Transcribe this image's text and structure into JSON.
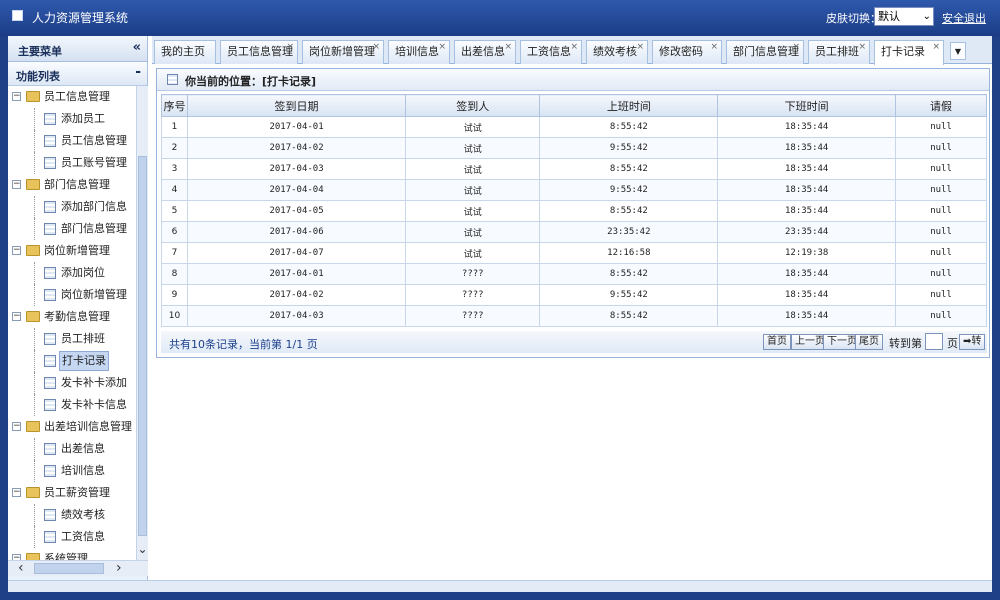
{
  "app": {
    "title": "人力资源管理系统",
    "skin_label": "皮肤切换：",
    "skin_value": "默认",
    "logout": "安全退出"
  },
  "sidebar": {
    "header": "主要菜单",
    "collapse_glyph": "«",
    "sub_header": "功能列表",
    "sub_toggle": "-",
    "groups": [
      {
        "label": "员工信息管理",
        "items": [
          "添加员工",
          "员工信息管理",
          "员工账号管理"
        ]
      },
      {
        "label": "部门信息管理",
        "items": [
          "添加部门信息",
          "部门信息管理"
        ]
      },
      {
        "label": "岗位新增管理",
        "items": [
          "添加岗位",
          "岗位新增管理"
        ]
      },
      {
        "label": "考勤信息管理",
        "items": [
          "员工排班",
          "打卡记录",
          "发卡补卡添加",
          "发卡补卡信息"
        ]
      },
      {
        "label": "出差培训信息管理",
        "items": [
          "出差信息",
          "培训信息"
        ]
      },
      {
        "label": "员工薪资管理",
        "items": [
          "绩效考核",
          "工资信息"
        ]
      },
      {
        "label": "系统管理",
        "items": []
      }
    ],
    "selected": "打卡记录"
  },
  "tabs": [
    "我的主页",
    "员工信息管理",
    "岗位新增管理",
    "培训信息",
    "出差信息",
    "工资信息",
    "绩效考核",
    "修改密码",
    "部门信息管理",
    "员工排班",
    "打卡记录"
  ],
  "active_tab": "打卡记录",
  "location": "你当前的位置：[打卡记录]",
  "table": {
    "headers": [
      "序号",
      "签到日期",
      "签到人",
      "上班时间",
      "下班时间",
      "请假"
    ],
    "rows": [
      [
        "1",
        "2017-04-01",
        "试试",
        "8:55:42",
        "18:35:44",
        "null"
      ],
      [
        "2",
        "2017-04-02",
        "试试",
        "9:55:42",
        "18:35:44",
        "null"
      ],
      [
        "3",
        "2017-04-03",
        "试试",
        "8:55:42",
        "18:35:44",
        "null"
      ],
      [
        "4",
        "2017-04-04",
        "试试",
        "9:55:42",
        "18:35:44",
        "null"
      ],
      [
        "5",
        "2017-04-05",
        "试试",
        "8:55:42",
        "18:35:44",
        "null"
      ],
      [
        "6",
        "2017-04-06",
        "试试",
        "23:35:42",
        "23:35:44",
        "null"
      ],
      [
        "7",
        "2017-04-07",
        "试试",
        "12:16:58",
        "12:19:38",
        "null"
      ],
      [
        "8",
        "2017-04-01",
        "????",
        "8:55:42",
        "18:35:44",
        "null"
      ],
      [
        "9",
        "2017-04-02",
        "????",
        "9:55:42",
        "18:35:44",
        "null"
      ],
      [
        "10",
        "2017-04-03",
        "????",
        "8:55:42",
        "18:35:44",
        "null"
      ]
    ]
  },
  "pager": {
    "summary": "共有10条记录，当前第 1/1 页",
    "first": "首页",
    "prev": "上一页",
    "next": "下一页",
    "last": "尾页",
    "goto_label": "转到第",
    "page_label": "页",
    "go": "➡转"
  }
}
